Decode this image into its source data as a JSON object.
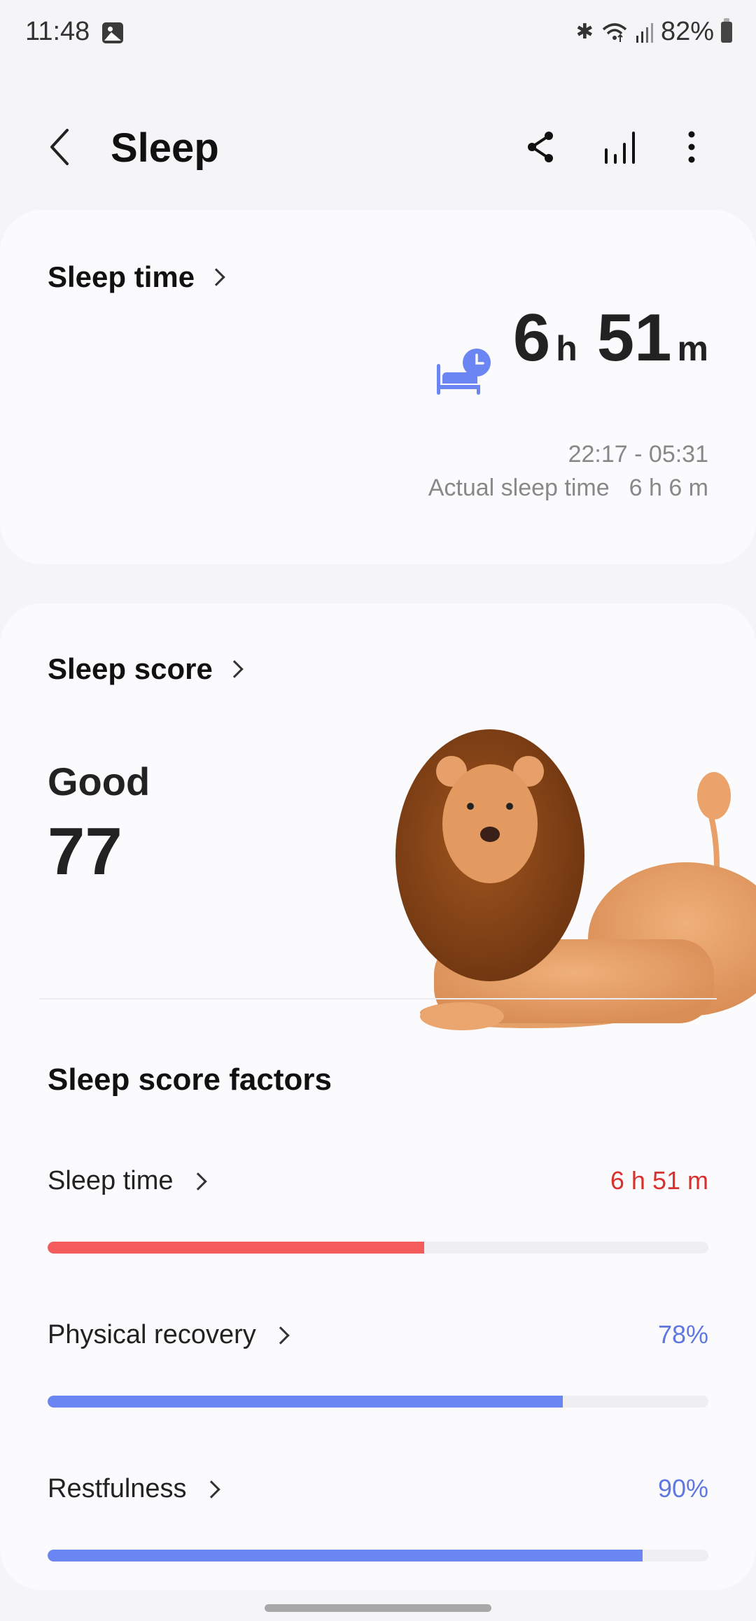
{
  "status_bar": {
    "time": "11:48",
    "battery": "82%",
    "icons": [
      "gallery-icon",
      "bluetooth-icon",
      "wifi-icon",
      "signal-icon",
      "battery-icon"
    ]
  },
  "header": {
    "title": "Sleep",
    "actions": [
      "share-icon",
      "chart-icon",
      "more-options-icon"
    ]
  },
  "sleep_time_card": {
    "title": "Sleep time",
    "duration_hours": "6",
    "hours_unit": "h",
    "duration_minutes": "51",
    "minutes_unit": "m",
    "range": "22:17 - 05:31",
    "actual_label": "Actual sleep time",
    "actual_value": "6 h 6 m",
    "icon": "bed-clock-icon",
    "accent_color": "#6b86f3"
  },
  "sleep_score_card": {
    "title": "Sleep score",
    "rating": "Good",
    "score": "77",
    "mascot": "lion-illustration",
    "factors_title": "Sleep score factors",
    "factors": [
      {
        "label": "Sleep time",
        "value": "6 h 51 m",
        "progress": 0.57,
        "color": "#f45b5b",
        "value_color": "#d7322f"
      },
      {
        "label": "Physical recovery",
        "value": "78%",
        "progress": 0.78,
        "color": "#6b86f3",
        "value_color": "#5f78e0"
      },
      {
        "label": "Restfulness",
        "value": "90%",
        "progress": 0.9,
        "color": "#6b86f3",
        "value_color": "#5f78e0"
      }
    ]
  }
}
